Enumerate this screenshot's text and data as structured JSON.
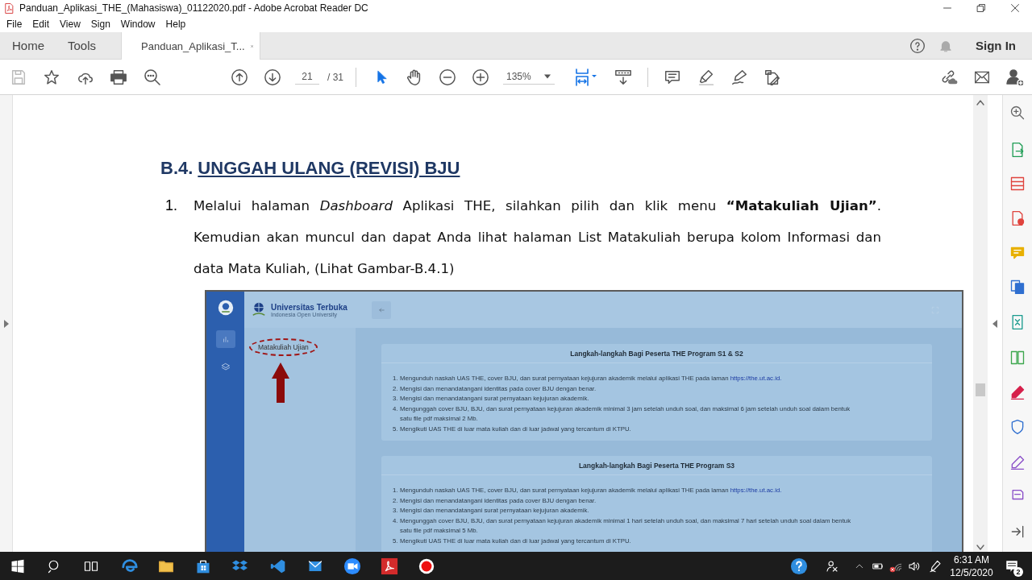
{
  "window": {
    "title": "Panduan_Aplikasi_THE_(Mahasiswa)_01122020.pdf - Adobe Acrobat Reader DC"
  },
  "menu": [
    "File",
    "Edit",
    "View",
    "Sign",
    "Window",
    "Help"
  ],
  "tabs": [
    {
      "label": "Home",
      "selected": false
    },
    {
      "label": "Tools",
      "selected": false
    },
    {
      "label": "Panduan_Aplikasi_T...",
      "selected": true
    }
  ],
  "sign_in": "Sign In",
  "toolbar": {
    "page": "21",
    "page_total": "/ 31",
    "zoom": "135%"
  },
  "document": {
    "section_number": "B.4.",
    "section_title": "UNGGAH ULANG (REVISI) BJU",
    "steps": [
      {
        "number": "1.",
        "text": "Melalui halaman *Dashboard* Aplikasi THE, silahkan pilih dan klik menu **“Matakuliah Ujian”**. Kemudian akan muncul dan dapat Anda lihat halaman List Matakuliah berupa kolom Informasi dan data Mata Kuliah, (Lihat Gambar-B.4.1)"
      }
    ],
    "figure": {
      "brand": "Universitas Terbuka",
      "brand_subtitle": "Indonesia Open University",
      "menu_item": "Matakuliah Ujian",
      "cards": [
        {
          "title": "Langkah-langkah Bagi Peserta THE Program S1 & S2",
          "items": [
            {
              "number": "1.",
              "text": "Mengunduh naskah UAS THE, cover BJU, dan surat pernyataan kejujuran akademik melalui aplikasi THE pada laman",
              "link": "https://the.ut.ac.id."
            },
            {
              "number": "2.",
              "text": "Mengisi dan menandatangani identitas pada cover BJU dengan benar."
            },
            {
              "number": "3.",
              "text": "Mengisi dan menandatangani surat pernyataan kejujuran akademik."
            },
            {
              "number": "4.",
              "text": "Mengunggah cover BJU, BJU, dan surat pernyataan kejujuran akademik minimal 3 jam setelah unduh soal, dan maksimal 6 jam setelah unduh soal dalam bentuk satu file pdf maksimal 2 Mb."
            },
            {
              "number": "5.",
              "text": "Mengikuti UAS THE di luar mata kuliah dan di luar jadwal yang tercantum di KTPU."
            }
          ]
        },
        {
          "title": "Langkah-langkah Bagi Peserta THE Program S3",
          "items": [
            {
              "number": "1.",
              "text": "Mengunduh naskah UAS THE, cover BJU, dan surat pernyataan kejujuran akademik melalui aplikasi THE pada laman",
              "link": "https://the.ut.ac.id."
            },
            {
              "number": "2.",
              "text": "Mengisi dan menandatangani identitas pada cover BJU dengan benar."
            },
            {
              "number": "3.",
              "text": "Mengisi dan menandatangani surat pernyataan kejujuran akademik."
            },
            {
              "number": "4.",
              "text": "Mengunggah cover BJU, BJU, dan surat pernyataan kejujuran akademik minimal 1 hari setelah unduh soal, dan maksimal 7 hari setelah unduh soal dalam bentuk satu file pdf maksimal 5 Mb."
            },
            {
              "number": "5.",
              "text": "Mengikuti UAS THE di luar mata kuliah dan di luar jadwal yang tercantum di KTPU."
            }
          ]
        }
      ]
    }
  },
  "taskbar": {
    "time": "6:31 AM",
    "date": "12/5/2020",
    "notifications": "2"
  }
}
